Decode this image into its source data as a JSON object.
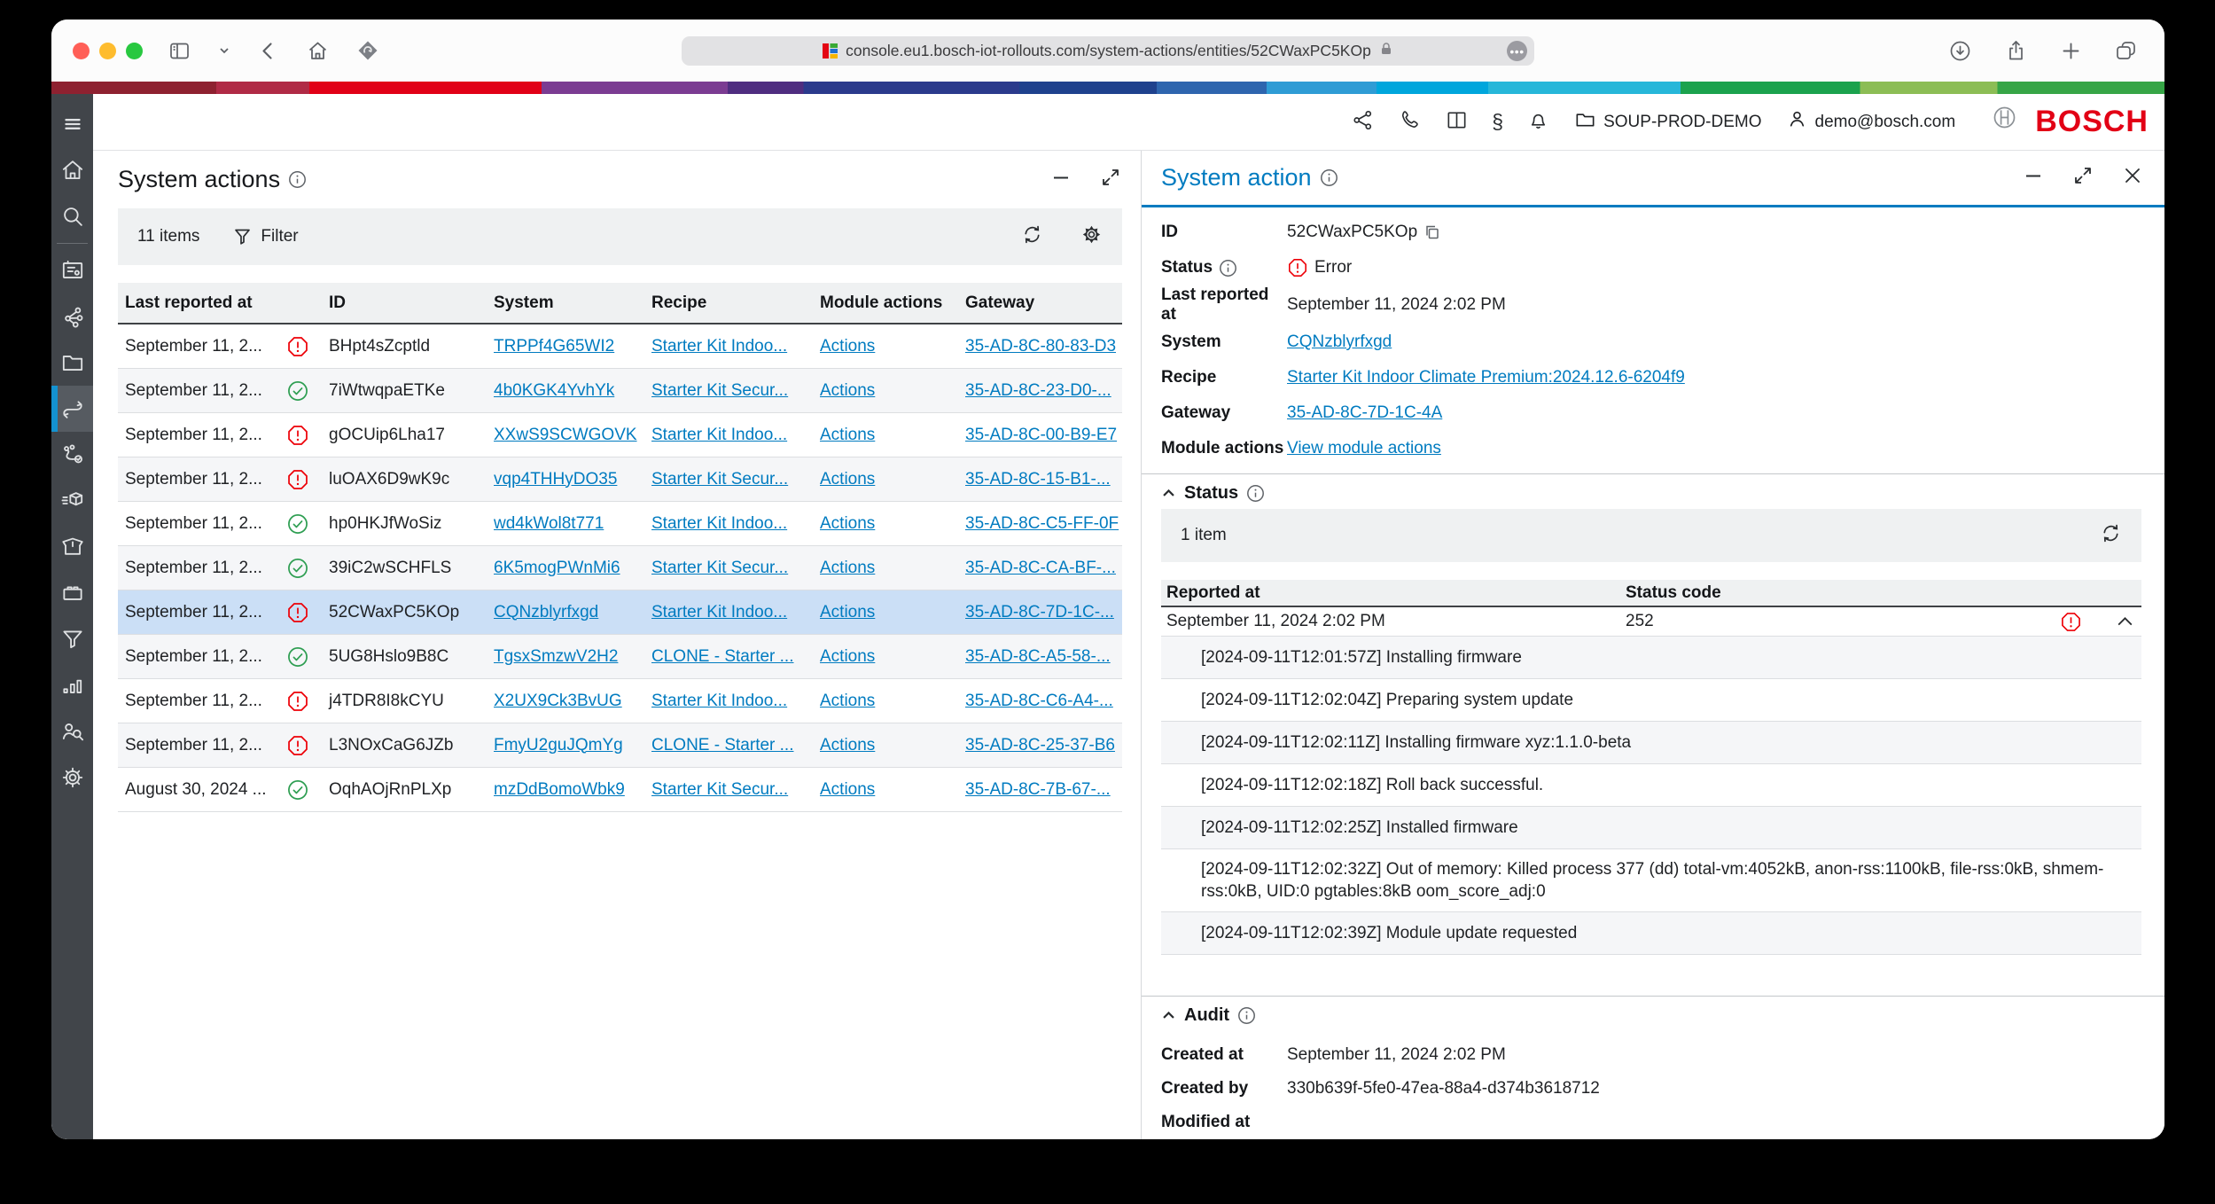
{
  "browser": {
    "url": "console.eu1.bosch-iot-rollouts.com/system-actions/entities/52CWaxPC5KOp"
  },
  "app_header": {
    "workspace": "SOUP-PROD-DEMO",
    "user": "demo@bosch.com",
    "brand": "BOSCH",
    "paragraph_glyph": "§"
  },
  "sidebar": {
    "items": [
      {
        "icon": "menu"
      },
      {
        "icon": "home"
      },
      {
        "icon": "search"
      },
      {
        "icon": "board"
      },
      {
        "icon": "network"
      },
      {
        "icon": "folder"
      },
      {
        "icon": "system-actions",
        "selected": true
      },
      {
        "icon": "route"
      },
      {
        "icon": "package"
      },
      {
        "icon": "box"
      },
      {
        "icon": "battery"
      },
      {
        "icon": "funnel"
      },
      {
        "icon": "chart"
      },
      {
        "icon": "users"
      },
      {
        "icon": "gear"
      }
    ]
  },
  "actions_panel": {
    "title": "System actions",
    "items_count": "11 items",
    "filter_label": "Filter",
    "columns": [
      "Last reported at",
      "ID",
      "System",
      "Recipe",
      "Module actions",
      "Gateway"
    ],
    "rows": [
      {
        "last_reported": "September 11, 2...",
        "status": "error",
        "id": "BHpt4sZcptld",
        "system": "TRPPf4G65WI2",
        "recipe": "Starter Kit Indoo...",
        "module_actions": "Actions",
        "gateway": "35-AD-8C-80-83-D3"
      },
      {
        "last_reported": "September 11, 2...",
        "status": "success",
        "id": "7iWtwqpaETKe",
        "system": "4b0KGK4YvhYk",
        "recipe": "Starter Kit Secur...",
        "module_actions": "Actions",
        "gateway": "35-AD-8C-23-D0-..."
      },
      {
        "last_reported": "September 11, 2...",
        "status": "error",
        "id": "gOCUip6Lha17",
        "system": "XXwS9SCWGOVK",
        "recipe": "Starter Kit Indoo...",
        "module_actions": "Actions",
        "gateway": "35-AD-8C-00-B9-E7"
      },
      {
        "last_reported": "September 11, 2...",
        "status": "error",
        "id": "luOAX6D9wK9c",
        "system": "vqp4THHyDO35",
        "recipe": "Starter Kit Secur...",
        "module_actions": "Actions",
        "gateway": "35-AD-8C-15-B1-..."
      },
      {
        "last_reported": "September 11, 2...",
        "status": "success",
        "id": "hp0HKJfWoSiz",
        "system": "wd4kWol8t771",
        "recipe": "Starter Kit Indoo...",
        "module_actions": "Actions",
        "gateway": "35-AD-8C-C5-FF-0F"
      },
      {
        "last_reported": "September 11, 2...",
        "status": "success",
        "id": "39iC2wSCHFLS",
        "system": "6K5mogPWnMi6",
        "recipe": "Starter Kit Secur...",
        "module_actions": "Actions",
        "gateway": "35-AD-8C-CA-BF-..."
      },
      {
        "last_reported": "September 11, 2...",
        "status": "error",
        "id": "52CWaxPC5KOp",
        "system": "CQNzblyrfxgd",
        "recipe": "Starter Kit Indoo...",
        "module_actions": "Actions",
        "gateway": "35-AD-8C-7D-1C-...",
        "selected": true
      },
      {
        "last_reported": "September 11, 2...",
        "status": "success",
        "id": "5UG8Hslo9B8C",
        "system": "TgsxSmzwV2H2",
        "recipe": "CLONE - Starter ...",
        "module_actions": "Actions",
        "gateway": "35-AD-8C-A5-58-..."
      },
      {
        "last_reported": "September 11, 2...",
        "status": "error",
        "id": "j4TDR8I8kCYU",
        "system": "X2UX9Ck3BvUG",
        "recipe": "Starter Kit Indoo...",
        "module_actions": "Actions",
        "gateway": "35-AD-8C-C6-A4-..."
      },
      {
        "last_reported": "September 11, 2...",
        "status": "error",
        "id": "L3NOxCaG6JZb",
        "system": "FmyU2guJQmYg",
        "recipe": "CLONE - Starter ...",
        "module_actions": "Actions",
        "gateway": "35-AD-8C-25-37-B6"
      },
      {
        "last_reported": "August 30, 2024 ...",
        "status": "success",
        "id": "OqhAOjRnPLXp",
        "system": "mzDdBomoWbk9",
        "recipe": "Starter Kit Secur...",
        "module_actions": "Actions",
        "gateway": "35-AD-8C-7B-67-..."
      }
    ]
  },
  "detail_panel": {
    "title": "System action",
    "fields": {
      "id_label": "ID",
      "id": "52CWaxPC5KOp",
      "status_label": "Status",
      "status": "Error",
      "last_reported_label": "Last reported at",
      "last_reported": "September 11, 2024 2:02 PM",
      "system_label": "System",
      "system": "CQNzblyrfxgd",
      "recipe_label": "Recipe",
      "recipe": "Starter Kit Indoor Climate Premium:2024.12.6-6204f9",
      "gateway_label": "Gateway",
      "gateway": "35-AD-8C-7D-1C-4A",
      "module_actions_label": "Module actions",
      "module_actions": "View module actions"
    },
    "status_section": {
      "title": "Status",
      "items_count": "1 item",
      "columns": [
        "Reported at",
        "Status code"
      ],
      "row": {
        "reported_at": "September 11, 2024 2:02 PM",
        "status_code": "252"
      },
      "logs": [
        "[2024-09-11T12:01:57Z] Installing firmware",
        "[2024-09-11T12:02:04Z] Preparing system update",
        "[2024-09-11T12:02:11Z] Installing firmware xyz:1.1.0-beta",
        "[2024-09-11T12:02:18Z] Roll back successful.",
        "[2024-09-11T12:02:25Z] Installed firmware",
        "[2024-09-11T12:02:32Z] Out of memory: Killed process 377 (dd) total-vm:4052kB, anon-rss:1100kB, file-rss:0kB, shmem-rss:0kB, UID:0 pgtables:8kB oom_score_adj:0",
        "[2024-09-11T12:02:39Z] Module update requested"
      ]
    },
    "audit_section": {
      "title": "Audit",
      "created_at_label": "Created at",
      "created_at": "September 11, 2024 2:02 PM",
      "created_by_label": "Created by",
      "created_by": "330b639f-5fe0-47ea-88a4-d374b3618712",
      "modified_at_label": "Modified at"
    }
  },
  "colors": {
    "accent": "#007bc0",
    "error": "#ed0007",
    "success": "#2e9e52",
    "selection": "#cbdff6",
    "rail_indicator": "#1492d0",
    "brand_red": "#e20015"
  }
}
